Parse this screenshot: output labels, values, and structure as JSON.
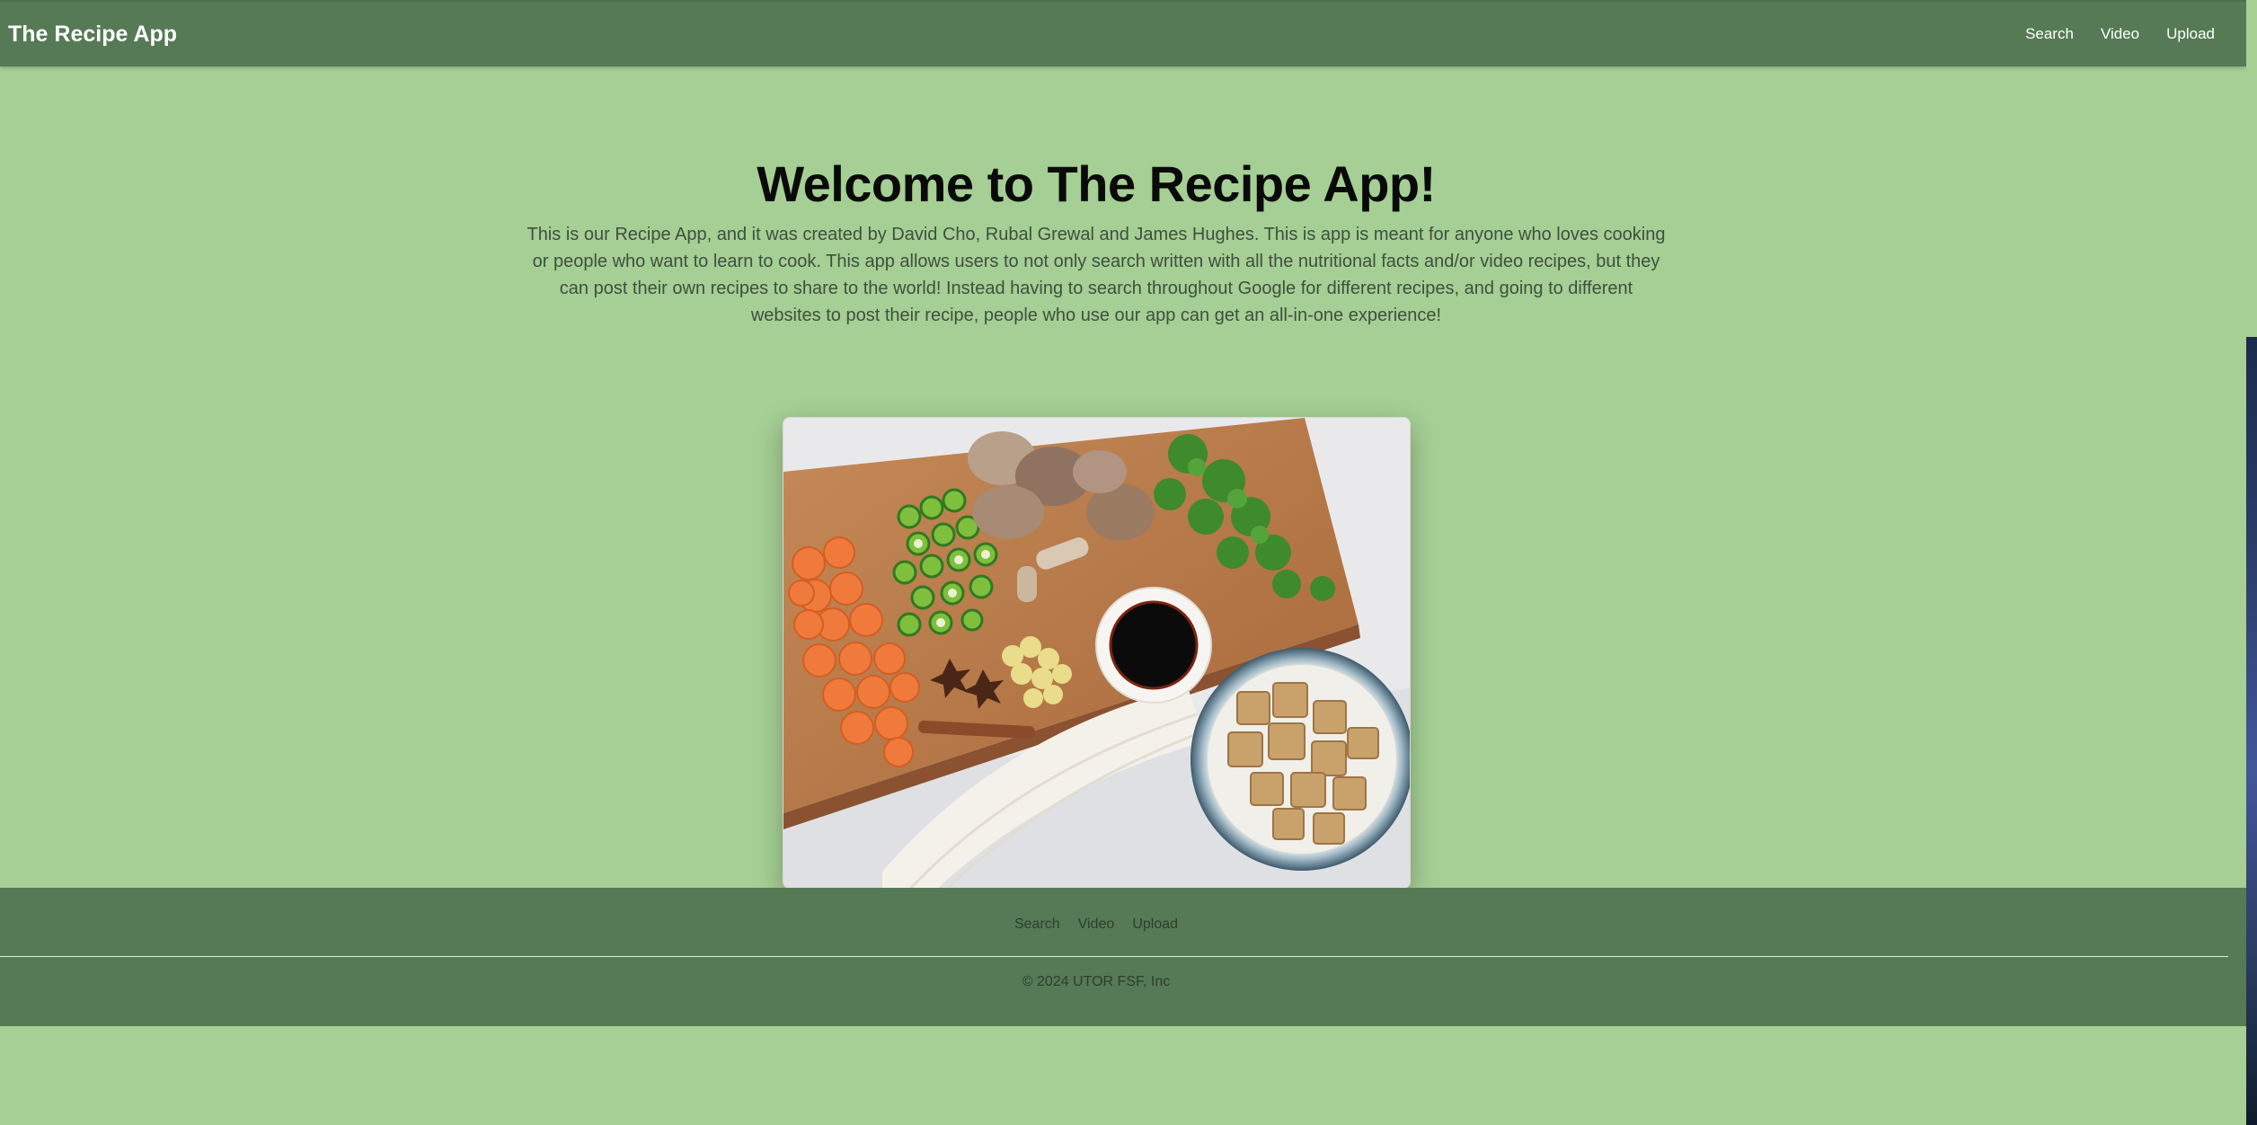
{
  "navbar": {
    "brand": "The Recipe App",
    "links": [
      "Search",
      "Video",
      "Upload"
    ]
  },
  "hero": {
    "title": "Welcome to The Recipe App!",
    "description": "This is our Recipe App, and it was created by David Cho, Rubal Grewal and James Hughes. This is app is meant for anyone who loves cooking or people who want to learn to cook. This app allows users to not only search written with all the nutritional facts and/or video recipes, but they can post their own recipes to share to the world! Instead having to search throughout Google for different recipes, and going to different websites to post their recipe, people who use our app can get an all-in-one experience!"
  },
  "footer": {
    "links": [
      "Search",
      "Video",
      "Upload"
    ],
    "copyright": "© 2024 UTOR FSF, Inc"
  },
  "colors": {
    "page_background": "#a5cf94",
    "navbar_background": "#557a55",
    "footer_background": "#557a55"
  }
}
